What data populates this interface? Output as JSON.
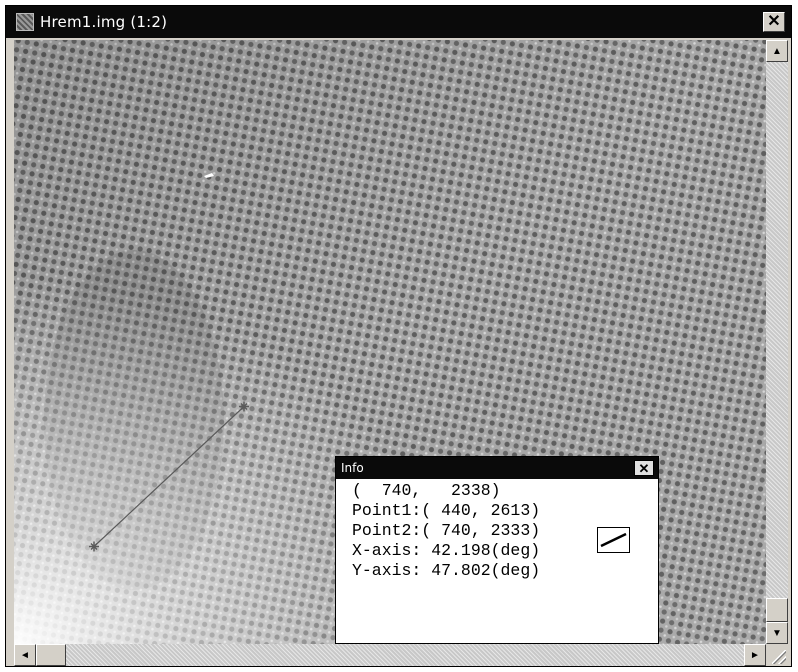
{
  "window": {
    "title": "Hrem1.img (1:2)",
    "close_glyph": "✕"
  },
  "measurement": {
    "point1": [
      440,
      2613
    ],
    "point2": [
      740,
      2333
    ],
    "marker_color": "#5a5a5a"
  },
  "info_panel": {
    "title": "Info",
    "close_glyph": "✕",
    "cursor": "(  740,   2338)",
    "point1": "Point1:( 440, 2613)",
    "point2": "Point2:( 740, 2333)",
    "x_axis": "X-axis: 42.198(deg)",
    "y_axis": "Y-axis: 47.802(deg)"
  },
  "scrollbars": {
    "up_arrow": "▲",
    "down_arrow": "▼",
    "left_arrow": "◄",
    "right_arrow": "►"
  },
  "icons": [
    "image-file-icon",
    "close-icon",
    "arrow-up-icon",
    "arrow-down-icon",
    "arrow-left-icon",
    "arrow-right-icon",
    "resize-grip-icon",
    "line-tool-icon"
  ]
}
